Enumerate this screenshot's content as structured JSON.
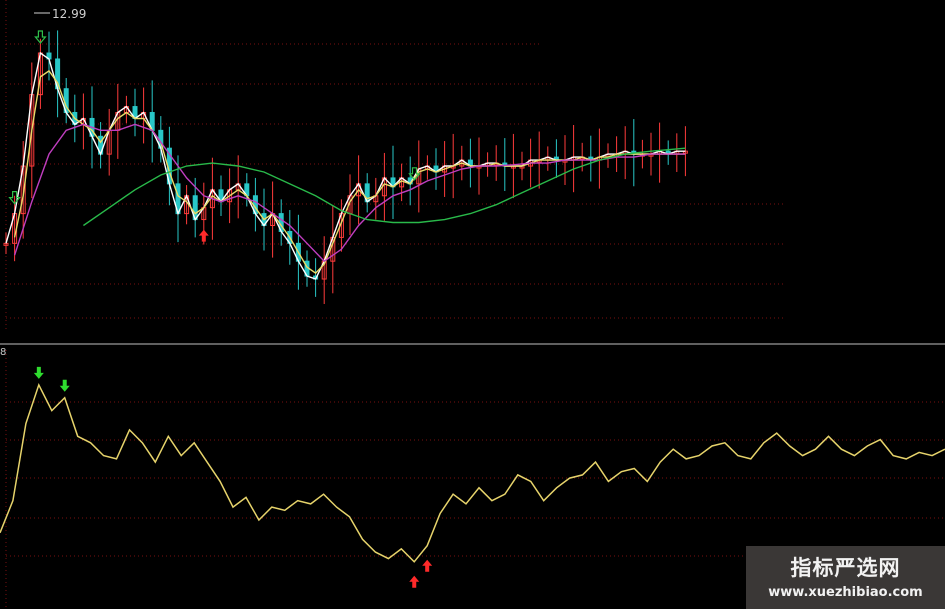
{
  "chart_data": [
    {
      "type": "candlestick",
      "panel": "price",
      "max_price_label": "12.99",
      "colors": {
        "background": "#000000",
        "up": "#ff3b3b",
        "down": "#29c7c7",
        "grid": "#7a1010"
      },
      "series": [
        {
          "key": "ma_white",
          "color": "#ffffff",
          "x": [
            0,
            2,
            4,
            6,
            8,
            10,
            12,
            14,
            16,
            18,
            20,
            22,
            24,
            26,
            28,
            30,
            32,
            34,
            36,
            38,
            40,
            42,
            44,
            46,
            48,
            50,
            52,
            54,
            56,
            58,
            60,
            62,
            64,
            66,
            68,
            70,
            72,
            74,
            76,
            78,
            80,
            82,
            84,
            86,
            88,
            90,
            92,
            94,
            96,
            98,
            100,
            102,
            104,
            106,
            108,
            110,
            112,
            114,
            116,
            118,
            120,
            122,
            124,
            126,
            128,
            130,
            132,
            134,
            136,
            138,
            140,
            142,
            144,
            146,
            148,
            150,
            152,
            154,
            156,
            158
          ],
          "y": [
            9.1,
            9.6,
            10.4,
            11.6,
            12.3,
            12.2,
            11.7,
            11.3,
            11.1,
            11.2,
            10.9,
            10.6,
            11.0,
            11.3,
            11.4,
            11.2,
            11.3,
            11.0,
            10.7,
            10.1,
            9.6,
            9.9,
            9.5,
            9.7,
            10.0,
            9.8,
            10.0,
            10.1,
            9.9,
            9.6,
            9.4,
            9.6,
            9.3,
            9.1,
            8.8,
            8.55,
            8.5,
            8.8,
            9.2,
            9.6,
            9.9,
            10.1,
            9.8,
            9.9,
            10.2,
            10.05,
            10.2,
            10.1,
            10.35,
            10.4,
            10.3,
            10.4,
            10.4,
            10.5,
            10.4,
            10.4,
            10.45,
            10.45,
            10.4,
            10.4,
            10.4,
            10.5,
            10.5,
            10.55,
            10.5,
            10.5,
            10.55,
            10.55,
            10.5,
            10.55,
            10.6,
            10.6,
            10.65,
            10.6,
            10.6,
            10.6,
            10.65,
            10.6,
            10.65,
            10.65
          ]
        },
        {
          "key": "ma_yellow",
          "color": "#e8dc6a",
          "x": [
            2,
            4,
            6,
            8,
            10,
            12,
            14,
            16,
            18,
            20,
            22,
            24,
            26,
            28,
            30,
            32,
            34,
            36,
            38,
            40,
            42,
            44,
            46,
            48,
            50,
            52,
            54,
            56,
            58,
            60,
            62,
            64,
            66,
            68,
            70,
            72,
            74,
            76,
            78,
            80,
            82,
            84,
            86,
            88,
            90,
            92,
            94,
            96,
            98,
            100,
            102,
            104,
            106,
            108,
            110,
            112,
            114,
            116,
            118,
            120,
            122,
            124,
            126,
            128,
            130,
            132,
            134,
            136,
            138,
            140,
            142,
            144,
            146,
            148,
            150,
            152,
            154,
            156,
            158
          ],
          "y": [
            9.2,
            9.9,
            11.0,
            11.9,
            12.0,
            11.8,
            11.4,
            11.2,
            11.1,
            11.0,
            10.8,
            11.0,
            11.2,
            11.3,
            11.2,
            11.2,
            11.0,
            10.8,
            10.3,
            9.9,
            9.8,
            9.6,
            9.7,
            9.9,
            9.8,
            9.9,
            10.0,
            9.9,
            9.7,
            9.5,
            9.6,
            9.4,
            9.2,
            8.95,
            8.7,
            8.6,
            8.75,
            9.1,
            9.45,
            9.8,
            10.0,
            9.85,
            9.9,
            10.1,
            10.05,
            10.15,
            10.1,
            10.3,
            10.35,
            10.3,
            10.35,
            10.4,
            10.45,
            10.4,
            10.4,
            10.4,
            10.45,
            10.4,
            10.4,
            10.4,
            10.45,
            10.5,
            10.5,
            10.5,
            10.5,
            10.5,
            10.55,
            10.5,
            10.55,
            10.55,
            10.6,
            10.6,
            10.6,
            10.6,
            10.6,
            10.6,
            10.6,
            10.6,
            10.6
          ]
        },
        {
          "key": "ma_magenta",
          "color": "#c03ec0",
          "x": [
            2,
            6,
            10,
            14,
            18,
            22,
            26,
            30,
            34,
            38,
            42,
            46,
            50,
            54,
            58,
            62,
            66,
            70,
            74,
            78,
            82,
            86,
            90,
            94,
            98,
            102,
            106,
            110,
            114,
            118,
            122,
            126,
            130,
            134,
            138,
            142,
            146,
            150,
            154,
            158
          ],
          "y": [
            8.9,
            9.8,
            10.6,
            11.0,
            11.1,
            11.0,
            11.0,
            11.1,
            11.0,
            10.6,
            10.2,
            9.9,
            9.8,
            9.9,
            9.8,
            9.6,
            9.4,
            9.1,
            8.8,
            9.0,
            9.4,
            9.7,
            9.9,
            10.0,
            10.15,
            10.25,
            10.35,
            10.4,
            10.4,
            10.42,
            10.45,
            10.45,
            10.5,
            10.5,
            10.5,
            10.55,
            10.55,
            10.6,
            10.6,
            10.6
          ]
        },
        {
          "key": "ma_green",
          "color": "#29b94a",
          "x": [
            18,
            24,
            30,
            36,
            42,
            48,
            54,
            60,
            66,
            72,
            78,
            84,
            90,
            96,
            102,
            108,
            114,
            120,
            126,
            132,
            138,
            144,
            150,
            158
          ],
          "y": [
            9.4,
            9.7,
            10.0,
            10.25,
            10.4,
            10.45,
            10.4,
            10.3,
            10.1,
            9.9,
            9.65,
            9.5,
            9.45,
            9.45,
            9.5,
            9.6,
            9.75,
            9.95,
            10.15,
            10.35,
            10.5,
            10.6,
            10.65,
            10.7
          ]
        }
      ],
      "signals": [
        {
          "kind": "buy",
          "x": 46,
          "color": "#ff2a2a"
        },
        {
          "kind": "sell",
          "x": 8,
          "color": "#2fbf4a"
        },
        {
          "kind": "sell",
          "x": 2,
          "color": "#2fbf4a"
        },
        {
          "kind": "sell",
          "x": 95,
          "color": "#2fbf4a"
        }
      ]
    },
    {
      "type": "line",
      "panel": "indicator",
      "colors": {
        "line": "#e6d36b",
        "grid": "#7a1010"
      },
      "series": [
        {
          "key": "indicator_line",
          "color": "#e6d36b",
          "x": [
            0,
            3,
            6,
            9,
            12,
            15,
            18,
            21,
            24,
            27,
            30,
            33,
            36,
            39,
            42,
            45,
            48,
            51,
            54,
            57,
            60,
            63,
            66,
            69,
            72,
            75,
            78,
            81,
            84,
            87,
            90,
            93,
            96,
            99,
            102,
            105,
            108,
            111,
            114,
            117,
            120,
            123,
            126,
            129,
            132,
            135,
            138,
            141,
            144,
            147,
            150,
            153,
            156,
            159,
            162,
            165,
            168,
            171,
            174,
            177,
            180,
            183,
            186,
            189,
            192,
            195,
            198,
            201,
            204,
            207,
            210,
            213,
            216,
            219
          ],
          "y": [
            5.0,
            10.0,
            22.0,
            28.0,
            24.0,
            26.0,
            20.0,
            19.0,
            17.0,
            16.5,
            21.0,
            19.0,
            16.0,
            20.0,
            17.0,
            19.0,
            16.0,
            13.0,
            9.0,
            10.5,
            7.0,
            9.0,
            8.5,
            10.0,
            9.5,
            11.0,
            9.0,
            7.5,
            4.0,
            2.0,
            1.0,
            2.5,
            0.5,
            3.0,
            8.0,
            11.0,
            9.5,
            12.0,
            10.0,
            11.0,
            14.0,
            13.0,
            10.0,
            12.0,
            13.5,
            14.0,
            16.0,
            13.0,
            14.5,
            15.0,
            13.0,
            16.0,
            18.0,
            16.5,
            17.0,
            18.5,
            19.0,
            17.0,
            16.5,
            19.0,
            20.5,
            18.5,
            17.0,
            18.0,
            20.0,
            18.0,
            17.0,
            18.5,
            19.5,
            17.0,
            16.5,
            17.5,
            17.0,
            18.0
          ]
        }
      ],
      "signals": [
        {
          "kind": "sell",
          "x": 9,
          "color": "#2fdc2f"
        },
        {
          "kind": "sell",
          "x": 15,
          "color": "#2fdc2f"
        },
        {
          "kind": "buy",
          "x": 96,
          "color": "#ff2a2a"
        },
        {
          "kind": "buy",
          "x": 99,
          "color": "#ff2a2a"
        }
      ]
    }
  ],
  "watermark": {
    "title": "指标严选网",
    "url": "www.xuezhibiao.com"
  },
  "indicator_axis_tick": "8"
}
